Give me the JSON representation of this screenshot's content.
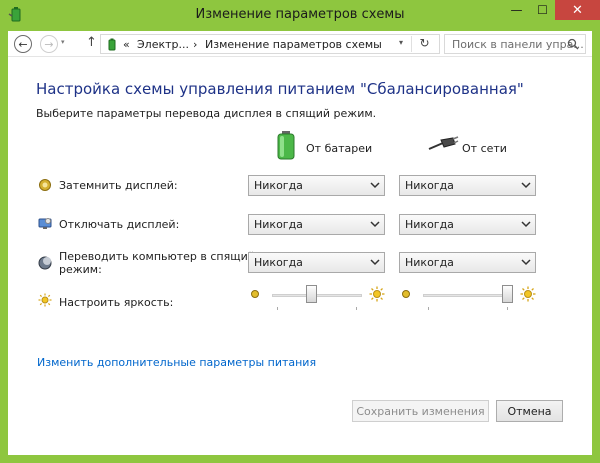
{
  "window": {
    "title": "Изменение параметров схемы",
    "close_glyph": "✕",
    "minimize_glyph": "—",
    "maximize_glyph": "☐"
  },
  "nav": {
    "back_glyph": "←",
    "forward_glyph": "→",
    "history_glyph": "▾",
    "up_glyph": "↑",
    "breadcrumbs": [
      "«",
      "Электр...",
      "›",
      "Изменение параметров схемы"
    ],
    "address_dropdown_glyph": "▾",
    "refresh_glyph": "↻",
    "search_placeholder": "Поиск в панели упра..."
  },
  "main": {
    "heading": "Настройка схемы управления питанием \"Сбалансированная\"",
    "subheading": "Выберите параметры перевода дисплея в спящий режим.",
    "columns": {
      "battery": "От батареи",
      "plugged": "От сети"
    },
    "rows": [
      {
        "label": "Затемнить дисплей:",
        "battery": "Никогда",
        "plugged": "Никогда",
        "icon": "dim-display-icon"
      },
      {
        "label": "Отключать дисплей:",
        "battery": "Никогда",
        "plugged": "Никогда",
        "icon": "display-off-icon"
      },
      {
        "label_line1": "Переводить компьютер в спящий",
        "label_line2": "режим:",
        "battery": "Никогда",
        "plugged": "Никогда",
        "icon": "sleep-icon"
      }
    ],
    "brightness": {
      "label": "Настроить яркость:",
      "battery_level": 0.43,
      "plugged_level": 1.0
    },
    "advanced_link": "Изменить дополнительные параметры питания"
  },
  "footer": {
    "save_label": "Сохранить изменения",
    "cancel_label": "Отмена"
  },
  "colors": {
    "titlebar": "#8ec63f",
    "close": "#c7463f",
    "heading": "#1e3287",
    "link": "#0066cc"
  }
}
